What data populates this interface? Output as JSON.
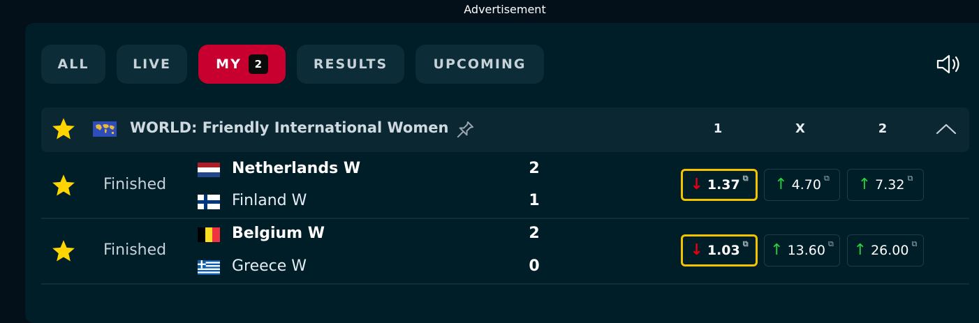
{
  "ad": {
    "label": "Advertisement"
  },
  "tabs": [
    {
      "label": "ALL"
    },
    {
      "label": "LIVE"
    },
    {
      "label": "MY",
      "badge": "2"
    },
    {
      "label": "RESULTS"
    },
    {
      "label": "UPCOMING"
    }
  ],
  "active_tab": "MY",
  "icons": {
    "sound": "speaker-icon",
    "star": "star-icon",
    "pin": "pin-icon",
    "collapse": "chevron-up-icon",
    "external": "external-link-icon"
  },
  "colors": {
    "accent": "#c8002f",
    "highlight": "#f4c300",
    "up": "#27d23c",
    "down": "#e10011",
    "star": "#ffd400"
  },
  "league": {
    "name": "WORLD: Friendly International Women",
    "columns": [
      "1",
      "X",
      "2"
    ]
  },
  "matches": [
    {
      "status": "Finished",
      "home": {
        "name": "Netherlands W",
        "score": "2",
        "winner": true
      },
      "away": {
        "name": "Finland W",
        "score": "1",
        "winner": false
      },
      "odds": [
        {
          "value": "1.37",
          "trend": "down",
          "highlighted": true
        },
        {
          "value": "4.70",
          "trend": "up",
          "highlighted": false
        },
        {
          "value": "7.32",
          "trend": "up",
          "highlighted": false
        }
      ]
    },
    {
      "status": "Finished",
      "home": {
        "name": "Belgium W",
        "score": "2",
        "winner": true
      },
      "away": {
        "name": "Greece W",
        "score": "0",
        "winner": false
      },
      "odds": [
        {
          "value": "1.03",
          "trend": "down",
          "highlighted": true
        },
        {
          "value": "13.60",
          "trend": "up",
          "highlighted": false
        },
        {
          "value": "26.00",
          "trend": "up",
          "highlighted": false
        }
      ]
    }
  ]
}
